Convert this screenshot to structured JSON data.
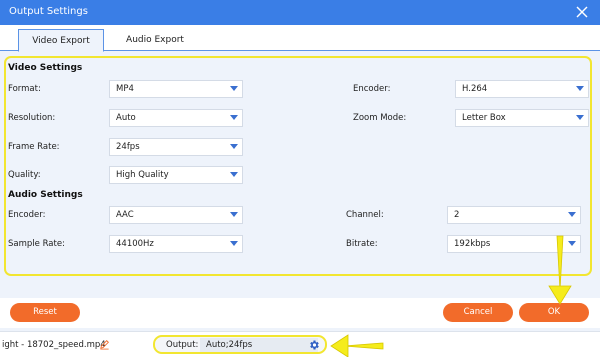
{
  "window": {
    "title": "Output Settings"
  },
  "tabs": [
    {
      "label": "Video Export",
      "active": true
    },
    {
      "label": "Audio Export",
      "active": false
    }
  ],
  "video_settings": {
    "title": "Video Settings",
    "format": {
      "label": "Format:",
      "value": "MP4"
    },
    "encoder": {
      "label": "Encoder:",
      "value": "H.264"
    },
    "resolution": {
      "label": "Resolution:",
      "value": "Auto"
    },
    "zoom_mode": {
      "label": "Zoom Mode:",
      "value": "Letter Box"
    },
    "frame_rate": {
      "label": "Frame Rate:",
      "value": "24fps"
    },
    "quality": {
      "label": "Quality:",
      "value": "High Quality"
    }
  },
  "audio_settings": {
    "title": "Audio Settings",
    "encoder": {
      "label": "Encoder:",
      "value": "AAC"
    },
    "channel": {
      "label": "Channel:",
      "value": "2"
    },
    "sample_rate": {
      "label": "Sample Rate:",
      "value": "44100Hz"
    },
    "bitrate": {
      "label": "Bitrate:",
      "value": "192kbps"
    }
  },
  "buttons": {
    "reset": "Reset",
    "cancel": "Cancel",
    "ok": "OK"
  },
  "statusbar": {
    "filename": "ight - 18702_speed.mp4",
    "output_label": "Output:",
    "output_value": "Auto;24fps"
  },
  "colors": {
    "titlebar": "#3a7ee6",
    "accent_button": "#f26b2a",
    "highlight": "#f2e630"
  },
  "icons": {
    "close": "close-icon",
    "edit": "pencil-icon",
    "settings": "gear-icon",
    "dropdown": "chevron-down-icon"
  }
}
